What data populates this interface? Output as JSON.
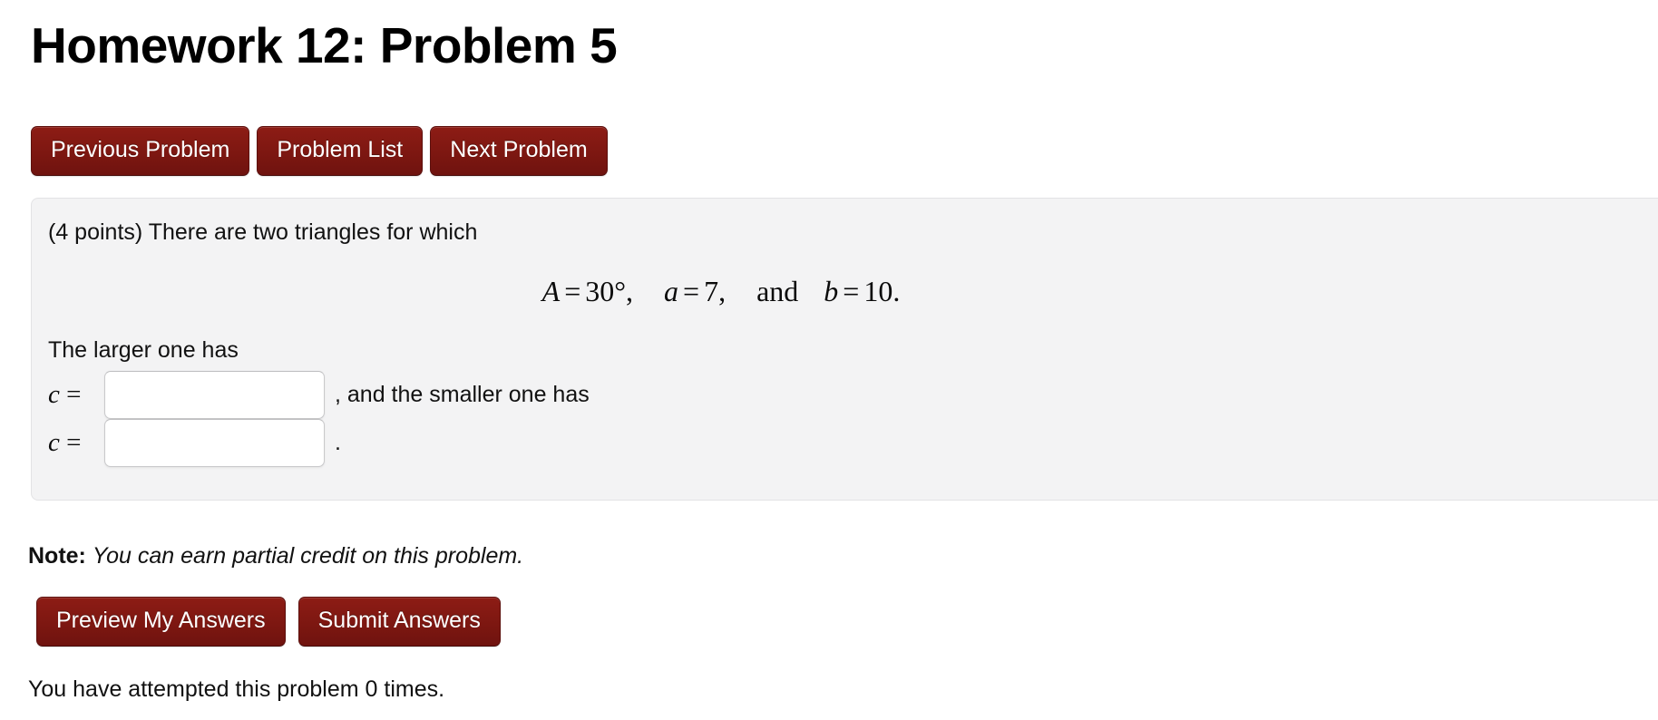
{
  "header": {
    "title": "Homework 12: Problem 5"
  },
  "nav": {
    "buttons": [
      {
        "name": "previous-problem-button",
        "label": "Previous Problem"
      },
      {
        "name": "problem-list-button",
        "label": "Problem List"
      },
      {
        "name": "next-problem-button",
        "label": "Next Problem"
      }
    ]
  },
  "problem": {
    "points_and_intro": "(4 points) There are two triangles for which",
    "math": {
      "var_A": "A",
      "eq1": "=",
      "val_A": "30°,",
      "var_a": "a",
      "eq2": "=",
      "val_a": "7,",
      "conjunction": "and",
      "var_b": "b",
      "eq3": "=",
      "val_b": "10."
    },
    "larger_label": "The larger one has",
    "answers": [
      {
        "name": "answer-c-larger",
        "var": "c",
        "equals": "=",
        "value": "",
        "placeholder": "",
        "trailing_text": ", and the smaller one has"
      },
      {
        "name": "answer-c-smaller",
        "var": "c",
        "equals": "=",
        "value": "",
        "placeholder": "",
        "trailing_text": "."
      }
    ]
  },
  "note": {
    "label": "Note:",
    "text": "You can earn partial credit on this problem."
  },
  "actions": {
    "buttons": [
      {
        "name": "preview-my-answers-button",
        "label": "Preview My Answers"
      },
      {
        "name": "submit-answers-button",
        "label": "Submit Answers"
      }
    ]
  },
  "status": {
    "attempts_text": "You have attempted this problem 0 times."
  },
  "colors": {
    "button_red": "#7d1711",
    "button_border": "#5d100d",
    "panel_bg": "#f3f3f4",
    "panel_border": "#e3e3e5",
    "text": "#111111",
    "input_border": "#c9c9cb",
    "page_bg": "#ffffff"
  }
}
